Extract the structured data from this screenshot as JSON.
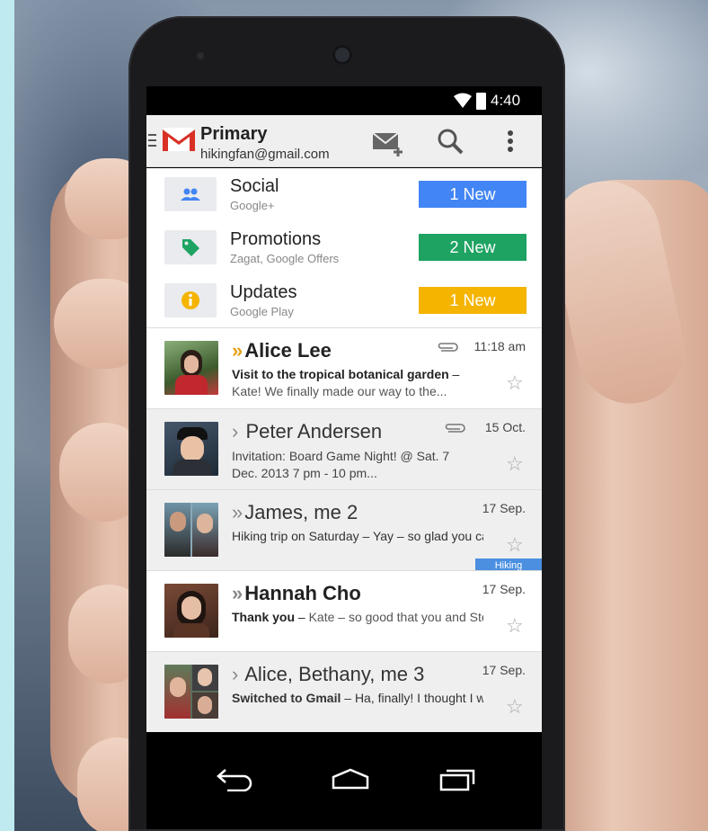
{
  "status_bar": {
    "time": "4:40"
  },
  "app_bar": {
    "title": "Primary",
    "account_email": "hikingfan@gmail.com"
  },
  "categories": [
    {
      "name": "Social",
      "subtitle": "Google+",
      "badge": "1 New",
      "badge_color": "#4285f4",
      "icon": "people-icon"
    },
    {
      "name": "Promotions",
      "subtitle": "Zagat, Google Offers",
      "badge": "2 New",
      "badge_color": "#1ea362",
      "icon": "tag-icon"
    },
    {
      "name": "Updates",
      "subtitle": "Google Play",
      "badge": "1 New",
      "badge_color": "#f4b400",
      "icon": "info-icon"
    }
  ],
  "emails": [
    {
      "sender": "Alice Lee",
      "subject": "Visit to the tropical botanical garden",
      "snippet": "Kate! We finally made our way to the...",
      "date": "11:18 am",
      "unread": true,
      "attachment": true,
      "important": true
    },
    {
      "sender": "Peter Andersen",
      "subject": "",
      "snippet": "Invitation: Board Game Night! @ Sat. 7 Dec. 2013 7 pm - 10 pm...",
      "date": "15 Oct.",
      "unread": false,
      "attachment": true,
      "important": false
    },
    {
      "sender": "James, me",
      "count": "2",
      "subject": "Hiking trip on Saturday",
      "snippet": "Yay – so glad you can come. We should leave...",
      "date": "17 Sep.",
      "unread": false,
      "attachment": false,
      "important": false,
      "label": "Hiking"
    },
    {
      "sender": "Hannah Cho",
      "subject": "Thank you",
      "snippet": "Kate – so good that you and Steve were able to come over....",
      "date": "17 Sep.",
      "unread": true,
      "attachment": false,
      "important": false
    },
    {
      "sender": "Alice, Bethany, me",
      "count": "3",
      "subject": "Switched to Gmail",
      "snippet": "Ha, finally! I thought I was going to have to nag you forever...",
      "date": "17 Sep.",
      "unread": false,
      "attachment": false,
      "important": false
    }
  ],
  "colors": {
    "gmail_red": "#d93025",
    "badge_blue": "#4285f4",
    "badge_green": "#1ea362",
    "badge_yellow": "#f4b400",
    "label_blue": "#4b8fe0"
  }
}
